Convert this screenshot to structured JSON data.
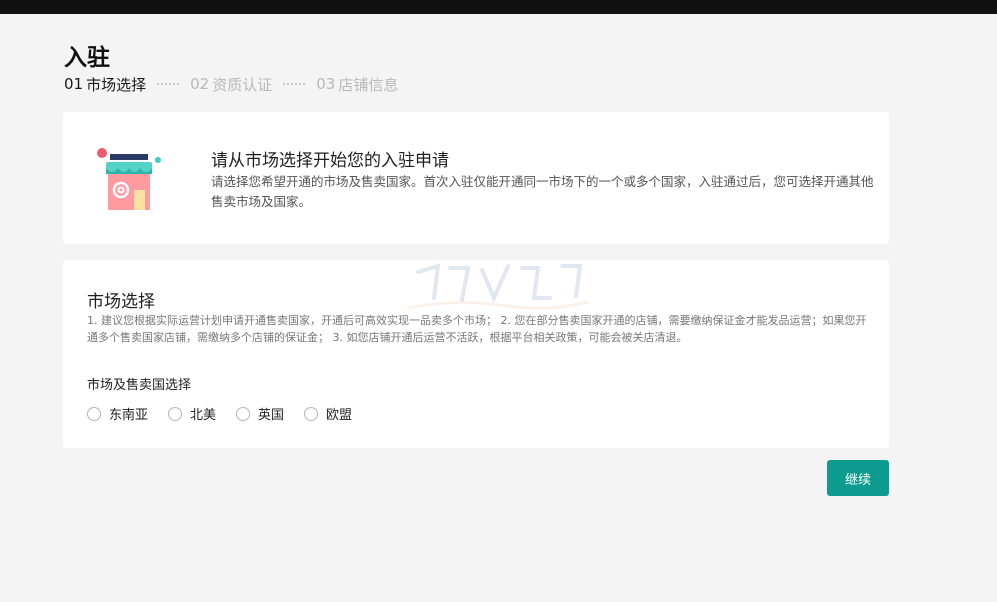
{
  "page": {
    "title": "入驻"
  },
  "steps": [
    {
      "num": "01",
      "label": "市场选择",
      "active": true
    },
    {
      "num": "02",
      "label": "资质认证",
      "active": false
    },
    {
      "num": "03",
      "label": "店铺信息",
      "active": false
    }
  ],
  "intro": {
    "title": "请从市场选择开始您的入驻申请",
    "description": "请选择您希望开通的市场及售卖国家。首次入驻仅能开通同一市场下的一个或多个国家，入驻通过后，您可选择开通其他售卖市场及国家。",
    "icon": "storefront-icon"
  },
  "market": {
    "title": "市场选择",
    "rules": "1. 建议您根据实际运营计划申请开通售卖国家，开通后可高效实现一品卖多个市场； 2. 您在部分售卖国家开通的店铺，需要缴纳保证金才能发品运营；如果您开通多个售卖国家店铺，需缴纳多个店铺的保证金； 3. 如您店铺开通后运营不活跃，根据平台相关政策，可能会被关店清退。",
    "field_label": "市场及售卖国选择",
    "options": [
      {
        "label": "东南亚",
        "selected": false
      },
      {
        "label": "北美",
        "selected": false
      },
      {
        "label": "英国",
        "selected": false
      },
      {
        "label": "欧盟",
        "selected": false
      }
    ]
  },
  "actions": {
    "continue_label": "继续"
  },
  "colors": {
    "accent": "#0d9b8f",
    "background": "#f4f4f4",
    "topbar": "#111111"
  }
}
